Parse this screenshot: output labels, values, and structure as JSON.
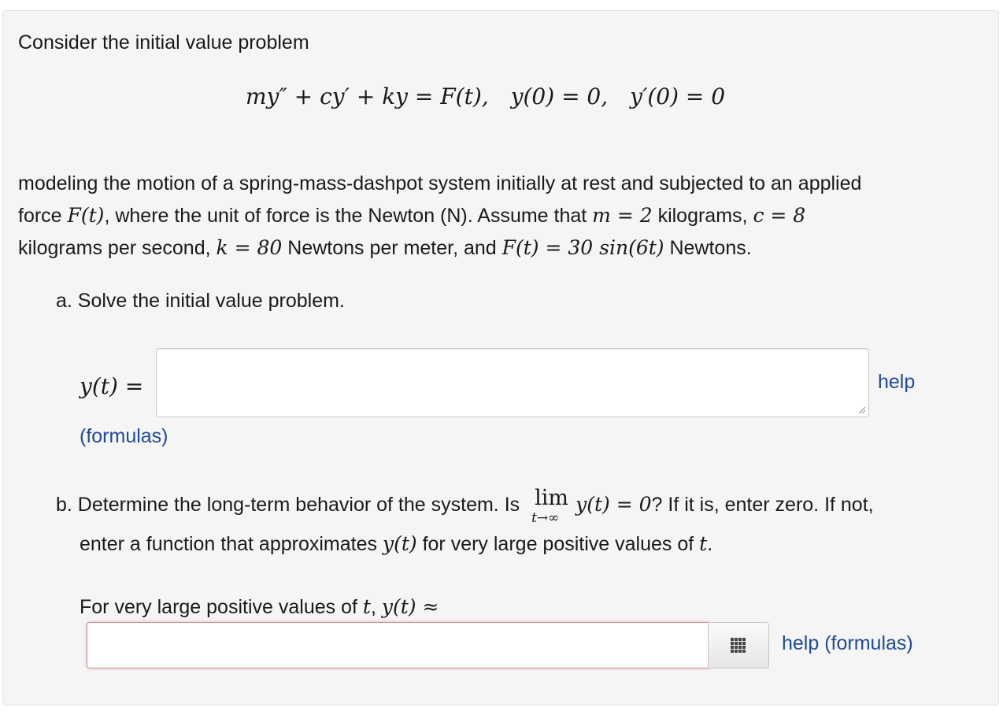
{
  "problem": {
    "intro": "Consider the initial value problem",
    "equation": {
      "lhs": "my″ + cy′ + ky = F(t),",
      "ic1": "y(0) = 0,",
      "ic2": "y′(0) = 0"
    },
    "paragraph": {
      "line1": "modeling the motion of a spring-mass-dashpot system initially at rest and subjected to an applied",
      "line2_a": "force ",
      "line2_math1": "F(t)",
      "line2_b": ", where the unit of force is the Newton (N). Assume that ",
      "line2_math2": "m = 2",
      "line2_c": " kilograms, ",
      "line2_math3": "c = 8",
      "line3_a": "kilograms per second, ",
      "line3_math1": "k = 80",
      "line3_b": " Newtons per meter, and ",
      "line3_math2": "F(t) = 30 sin(6t)",
      "line3_c": " Newtons."
    }
  },
  "part_a": {
    "prompt": "a. Solve the initial value problem.",
    "label": "y(t) =",
    "answer_value": "",
    "help_link": "help",
    "formulas_link": "(formulas)"
  },
  "part_b": {
    "prompt_a": "b. Determine the long-term behavior of the system. Is ",
    "lim_word": "lim",
    "lim_sub": "t→∞",
    "prompt_math": "y(t) = 0",
    "prompt_b": "? If it is, enter zero. If not,",
    "line2_a": "enter a function that approximates ",
    "line2_math": "y(t)",
    "line2_b": " for very large positive values of ",
    "line2_math2": "t",
    "line2_c": ".",
    "line3_a": "For very large positive values of ",
    "line3_math1": "t",
    "line3_b": ", ",
    "line3_math2": "y(t) ≈",
    "answer_value": "",
    "palette_icon": "grid-palette-icon",
    "help_link": "help (formulas)"
  },
  "colors": {
    "link": "#1f4a9a",
    "invalid_border": "#d28a8a",
    "card_background": "#f5f5f5"
  }
}
